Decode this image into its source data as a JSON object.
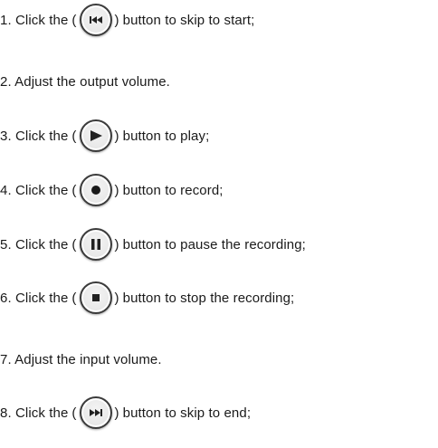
{
  "steps": [
    {
      "prefix": "1. Click the",
      "open": "(",
      "close": ")",
      "suffix": "button to skip to start;",
      "icon": "skip-to-start-icon"
    },
    {
      "text": "2. Adjust the output volume."
    },
    {
      "prefix": "3. Click the",
      "open": "(",
      "close": ")",
      "suffix": "button to play;",
      "icon": "play-icon"
    },
    {
      "prefix": "4. Click the",
      "open": "(",
      "close": ")",
      "suffix": "button to record;",
      "icon": "record-icon"
    },
    {
      "prefix": "5. Click the",
      "open": "(",
      "close": ")",
      "suffix": "button to pause the recording;",
      "icon": "pause-icon"
    },
    {
      "prefix": "6. Click the",
      "open": "(",
      "close": ")",
      "suffix": "button to stop the recording;",
      "icon": "stop-icon"
    },
    {
      "text": "7. Adjust the input volume."
    },
    {
      "prefix": "8. Click the",
      "open": "(",
      "close": ")",
      "suffix": "button to skip to end;",
      "icon": "skip-to-end-icon"
    }
  ]
}
